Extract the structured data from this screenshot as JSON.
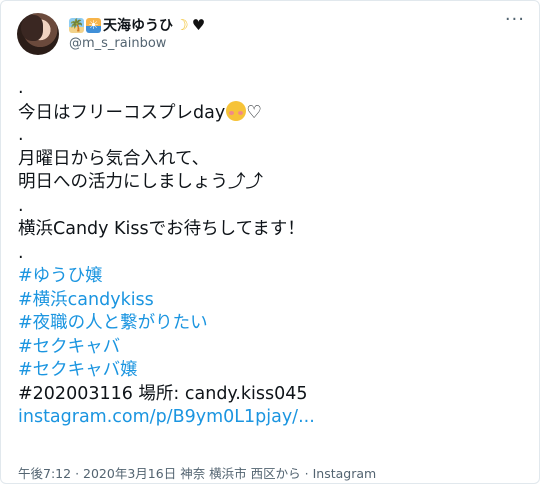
{
  "author": {
    "display_name": "天海ゆうひ",
    "handle": "@m_s_rainbow",
    "name_emojis": [
      "palm-tree-emoji",
      "sunrise-emoji",
      "crescent-moon-emoji",
      "black-heart-emoji"
    ]
  },
  "tweet": {
    "lines": [
      {
        "type": "dot",
        "text": "."
      },
      {
        "type": "text",
        "text": "今日はフリーコスプレday",
        "suffix_heart": "♡"
      },
      {
        "type": "dot",
        "text": "."
      },
      {
        "type": "text",
        "text": "月曜日から気合入れて、"
      },
      {
        "type": "text",
        "text": "明日への活力にしましょう⤴︎⤴︎"
      },
      {
        "type": "dot",
        "text": "."
      },
      {
        "type": "text",
        "text": "横浜Candy Kissでお待ちしてます！"
      },
      {
        "type": "dot",
        "text": "."
      }
    ],
    "hashtags": [
      "#ゆうひ嬢",
      "#横浜candykiss",
      "#夜職の人と繋がりたい",
      "#セクキャバ",
      "#セクキャバ嬢"
    ],
    "date_line": "#202003116 場所: candy.kiss045",
    "link": "instagram.com/p/B9ym0L1pjay/..."
  },
  "footer": {
    "time": "午後7:12",
    "date": "2020年3月16日",
    "location": "神奈 横浜市 西区から",
    "source": "Instagram"
  },
  "colors": {
    "link": "#1b95e0",
    "text": "#0f1419",
    "muted": "#536471"
  }
}
